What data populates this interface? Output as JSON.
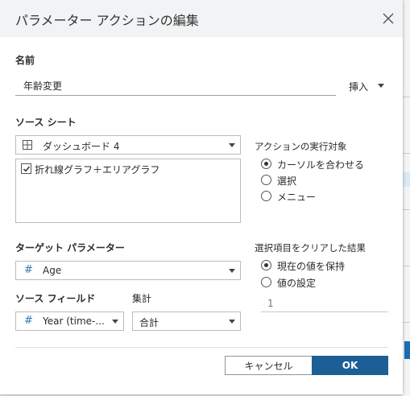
{
  "dialog": {
    "title": "パラメーター アクションの編集"
  },
  "name": {
    "label": "名前",
    "value": "年齢変更",
    "insert_label": "挿入"
  },
  "source_sheet": {
    "label": "ソース シート",
    "selected": "ダッシュボード 4",
    "icon": "dashboard-grid-icon",
    "sheets": [
      {
        "label": "折れ線グラフ＋エリアグラフ",
        "checked": true
      }
    ]
  },
  "run_on": {
    "label": "アクションの実行対象",
    "options": [
      {
        "label": "カーソルを合わせる",
        "selected": true
      },
      {
        "label": "選択",
        "selected": false
      },
      {
        "label": "メニュー",
        "selected": false
      }
    ]
  },
  "target_parameter": {
    "label": "ターゲット パラメーター",
    "selected": "Age",
    "icon": "hash-icon"
  },
  "source_field": {
    "label": "ソース フィールド",
    "selected": "Year (time-...",
    "icon": "hash-icon"
  },
  "aggregation": {
    "label": "集計",
    "selected": "合計"
  },
  "clear_result": {
    "label": "選択項目をクリアした結果",
    "options": [
      {
        "label": "現在の値を保持",
        "selected": true
      },
      {
        "label": "値の設定",
        "selected": false
      }
    ],
    "value_placeholder": "1"
  },
  "buttons": {
    "cancel": "キャンセル",
    "ok": "OK"
  },
  "colors": {
    "ok_button": "#1c5f96",
    "hash_icon": "#2b7bb9"
  }
}
